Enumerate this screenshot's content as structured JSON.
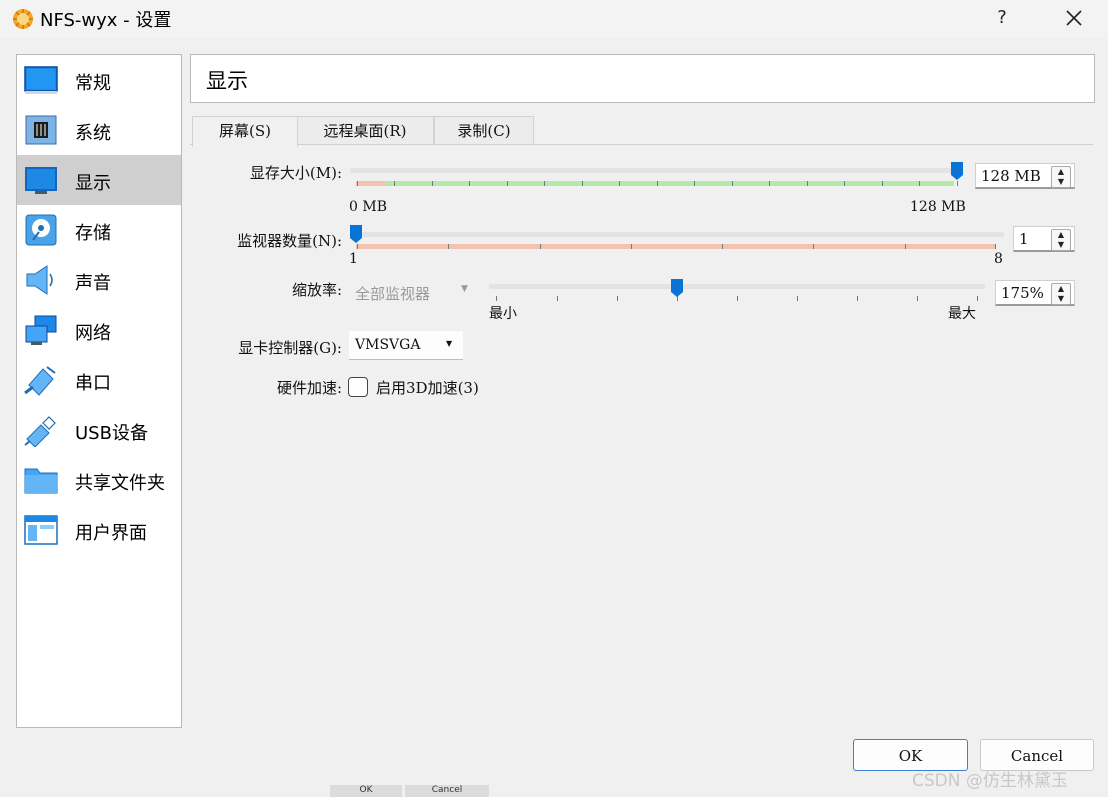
{
  "window": {
    "title": "NFS-wyx - 设置",
    "help_label": "?",
    "close_icon": "close-icon"
  },
  "sidebar": {
    "items": [
      {
        "label": "常规",
        "icon": "general-monitor-icon",
        "selected": false
      },
      {
        "label": "系统",
        "icon": "chip-icon",
        "selected": false
      },
      {
        "label": "显示",
        "icon": "display-icon",
        "selected": true
      },
      {
        "label": "存储",
        "icon": "storage-disk-icon",
        "selected": false
      },
      {
        "label": "声音",
        "icon": "speaker-icon",
        "selected": false
      },
      {
        "label": "网络",
        "icon": "network-icon",
        "selected": false
      },
      {
        "label": "串口",
        "icon": "serial-port-icon",
        "selected": false
      },
      {
        "label": "USB设备",
        "icon": "usb-icon",
        "selected": false
      },
      {
        "label": "共享文件夹",
        "icon": "folder-icon",
        "selected": false
      },
      {
        "label": "用户界面",
        "icon": "user-interface-icon",
        "selected": false
      }
    ]
  },
  "header": {
    "title": "显示"
  },
  "tabs": [
    {
      "label": "屏幕(S)",
      "active": true
    },
    {
      "label": "远程桌面(R)",
      "active": false
    },
    {
      "label": "录制(C)",
      "active": false
    }
  ],
  "screen": {
    "video_memory": {
      "label": "显存大小(M):",
      "value": "128 MB",
      "min_label": "0 MB",
      "max_label": "128 MB",
      "fraction": 1.0
    },
    "monitor_count": {
      "label": "监视器数量(N):",
      "value": "1",
      "min_label": "1",
      "max_label": "8",
      "fraction": 0.0
    },
    "scale": {
      "label": "缩放率:",
      "monitor_select": "全部监视器",
      "value": "175%",
      "min_label": "最小",
      "max_label": "最大",
      "fraction": 0.375
    },
    "graphics_controller": {
      "label": "显卡控制器(G):",
      "value": "VMSVGA"
    },
    "acceleration": {
      "label": "硬件加速:",
      "checkbox_label": "启用3D加速(3)",
      "checked": false
    }
  },
  "footer": {
    "ok_label": "OK",
    "cancel_label": "Cancel"
  },
  "background_window": {
    "ok_label": "OK",
    "cancel_label": "Cancel"
  },
  "watermark": "CSDN @仿生林黛玉",
  "colors": {
    "accent": "#0a74d6",
    "green_range": "#b6e8a8",
    "red_range": "#f3c3b2",
    "selected": "#cfcfcf"
  }
}
